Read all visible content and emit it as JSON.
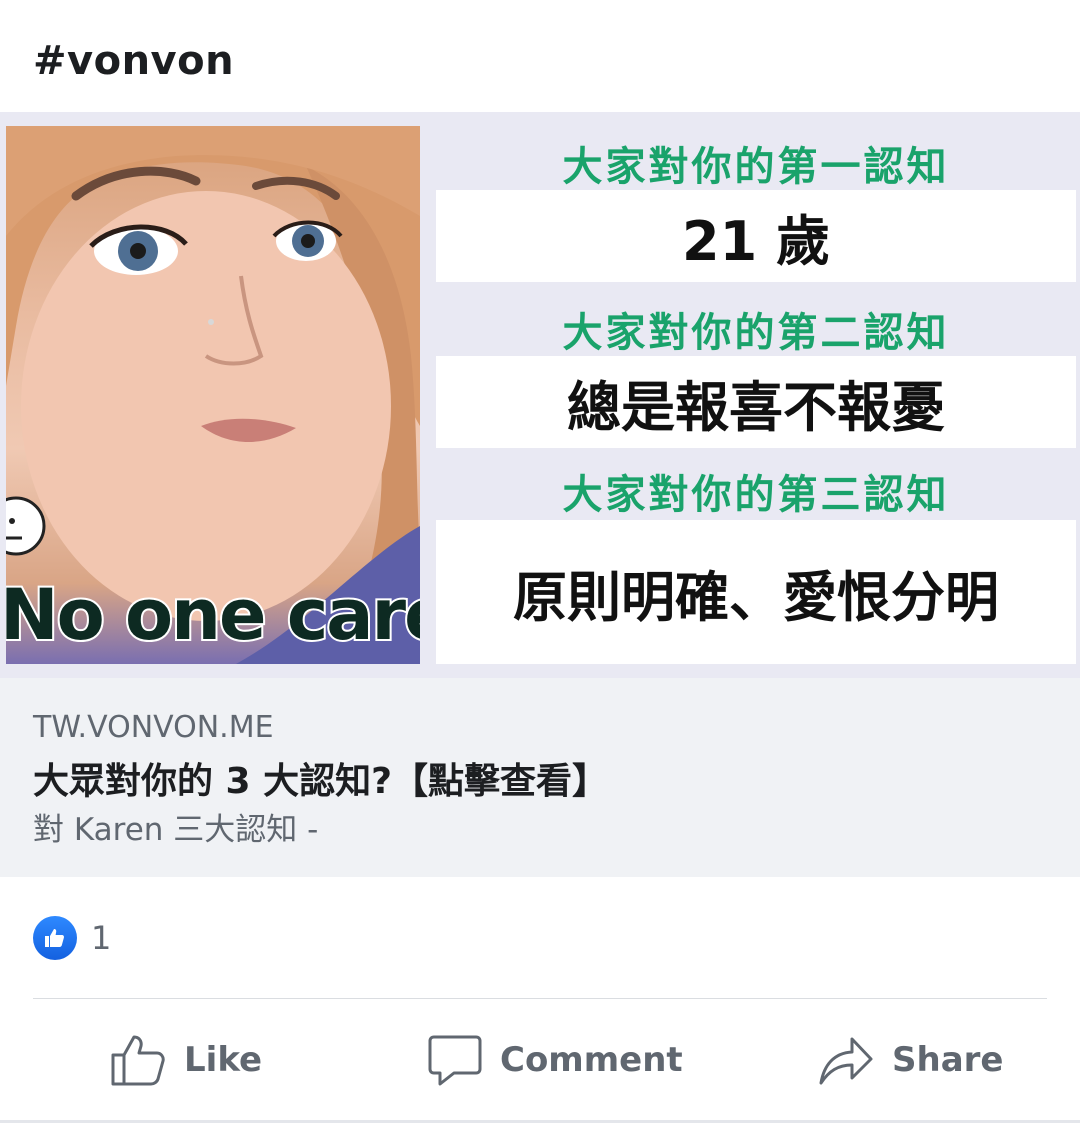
{
  "post": {
    "hashtag": "#vonvon"
  },
  "link_preview": {
    "image": {
      "photo_caption": "No one care",
      "headings": [
        "大家對你的第一認知",
        "大家對你的第二認知",
        "大家對你的第三認知"
      ],
      "answers": [
        "21 歲",
        "總是報喜不報憂",
        "原則明確、愛恨分明"
      ]
    },
    "domain": "TW.VONVON.ME",
    "title": "大眾對你的 3 大認知?【點擊查看】",
    "description": "對 Karen 三大認知 -"
  },
  "reactions": {
    "icon": "like-icon",
    "count": "1"
  },
  "actions": {
    "like_label": "Like",
    "comment_label": "Comment",
    "share_label": "Share"
  },
  "colors": {
    "heading_green": "#1aa36b",
    "like_blue": "#1877f2",
    "secondary_text": "#606770"
  }
}
